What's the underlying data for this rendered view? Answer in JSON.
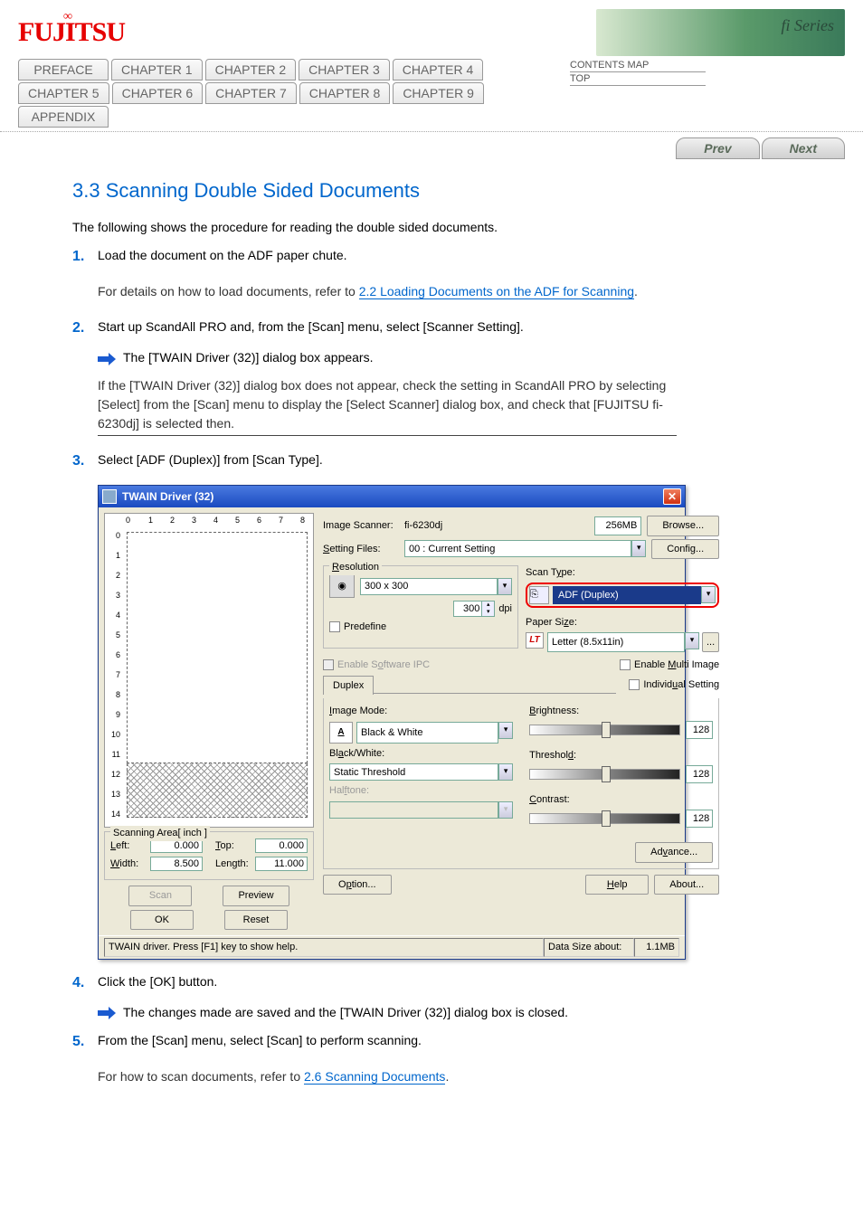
{
  "header": {
    "logo_text": "FUJITSU",
    "series_label": "fi Series"
  },
  "nav": {
    "tabs": [
      "PREFACE",
      "CHAPTER 1",
      "CHAPTER 2",
      "CHAPTER 3",
      "CHAPTER 4",
      "CHAPTER 5",
      "CHAPTER 6",
      "CHAPTER 7",
      "CHAPTER 8",
      "CHAPTER 9",
      "APPENDIX"
    ],
    "side": [
      "CONTENTS MAP",
      "TOP"
    ]
  },
  "pager": {
    "prev": "Prev",
    "next": "Next"
  },
  "doc": {
    "title": "3.3 Scanning Double Sided Documents",
    "intro_1": "The following shows the procedure for reading the double sided documents.",
    "step1_num": "1.",
    "step1_text_a": "Load the document on the ADF paper chute.",
    "step1_hint_label": "For details on how to load documents, refer to ",
    "step1_hint_link": "2.2 Loading Documents on the ADF for Scanning",
    "step1_hint_tail": ".",
    "step2_num": "2.",
    "step2_text": "Start up ScandAll PRO and, from the [Scan] menu, select [Scanner Setting].",
    "step2_result": "The [TWAIN Driver (32)] dialog box appears.",
    "step2_hint": "If the [TWAIN Driver (32)] dialog box does not appear, check the setting in ScandAll PRO by selecting [Select] from the [Scan] menu to display the [Select Scanner] dialog box, and check that [FUJITSU fi-6230dj] is selected then.",
    "step3_num": "3.",
    "step3_text": "Select [ADF (Duplex)] from [Scan Type].",
    "step4_num": "4.",
    "step4_text": "Click the [OK] button.",
    "step4_result": "The changes made are saved and the [TWAIN Driver (32)] dialog box is closed.",
    "step5_num": "5.",
    "step5_text_a": "From the [Scan] menu, select [Scan] to perform scanning.",
    "step5_hint": "For how to scan documents, refer to ",
    "step5_link": "2.6 Scanning Documents",
    "step5_tail": "."
  },
  "twain": {
    "title": "TWAIN Driver (32)",
    "scanner_label": "Image Scanner:",
    "scanner_value": "fi-6230dj",
    "mem": "256MB",
    "browse": "Browse...",
    "setting_files_label": "Setting Files:",
    "setting_files_value": "00 : Current Setting",
    "config": "Config...",
    "resolution_label": "Resolution",
    "resolution_value": "300 x 300",
    "resolution_num": "300",
    "dpi": "dpi",
    "predefine": "Predefine",
    "scan_type_label": "Scan Type:",
    "scan_type_value": "ADF (Duplex)",
    "paper_size_label": "Paper Size:",
    "paper_size_value": "Letter (8.5x11in)",
    "ps_icon": "LT",
    "enable_sw_ipc": "Enable Software IPC",
    "enable_multi": "Enable Multi Image",
    "duplex_tab": "Duplex",
    "individual": "Individual Setting",
    "image_mode_label": "Image Mode:",
    "image_mode_value": "Black & White",
    "im_icon": "A",
    "black_white_label": "Black/White:",
    "black_white_value": "Static Threshold",
    "halftone_label": "Halftone:",
    "brightness_label": "Brightness:",
    "brightness_value": "128",
    "threshold_label": "Threshold:",
    "threshold_value": "128",
    "contrast_label": "Contrast:",
    "contrast_value": "128",
    "advance": "Advance...",
    "option": "Option...",
    "help": "Help",
    "about": "About...",
    "scan_btn": "Scan",
    "preview_btn": "Preview",
    "ok_btn": "OK",
    "reset_btn": "Reset",
    "scanning_area_label": "Scanning Area[ inch ]",
    "left_label": "Left:",
    "left_value": "0.000",
    "top_label": "Top:",
    "top_value": "0.000",
    "width_label": "Width:",
    "width_value": "8.500",
    "length_label": "Length:",
    "length_value": "11.000",
    "status_left": "TWAIN driver. Press [F1] key to show help.",
    "status_right_label": "Data Size about:",
    "status_right_value": "1.1MB",
    "ruler_h": [
      "0",
      "1",
      "2",
      "3",
      "4",
      "5",
      "6",
      "7",
      "8"
    ],
    "ruler_v": [
      "0",
      "1",
      "2",
      "3",
      "4",
      "5",
      "6",
      "7",
      "8",
      "9",
      "10",
      "11",
      "12",
      "13",
      "14"
    ]
  }
}
